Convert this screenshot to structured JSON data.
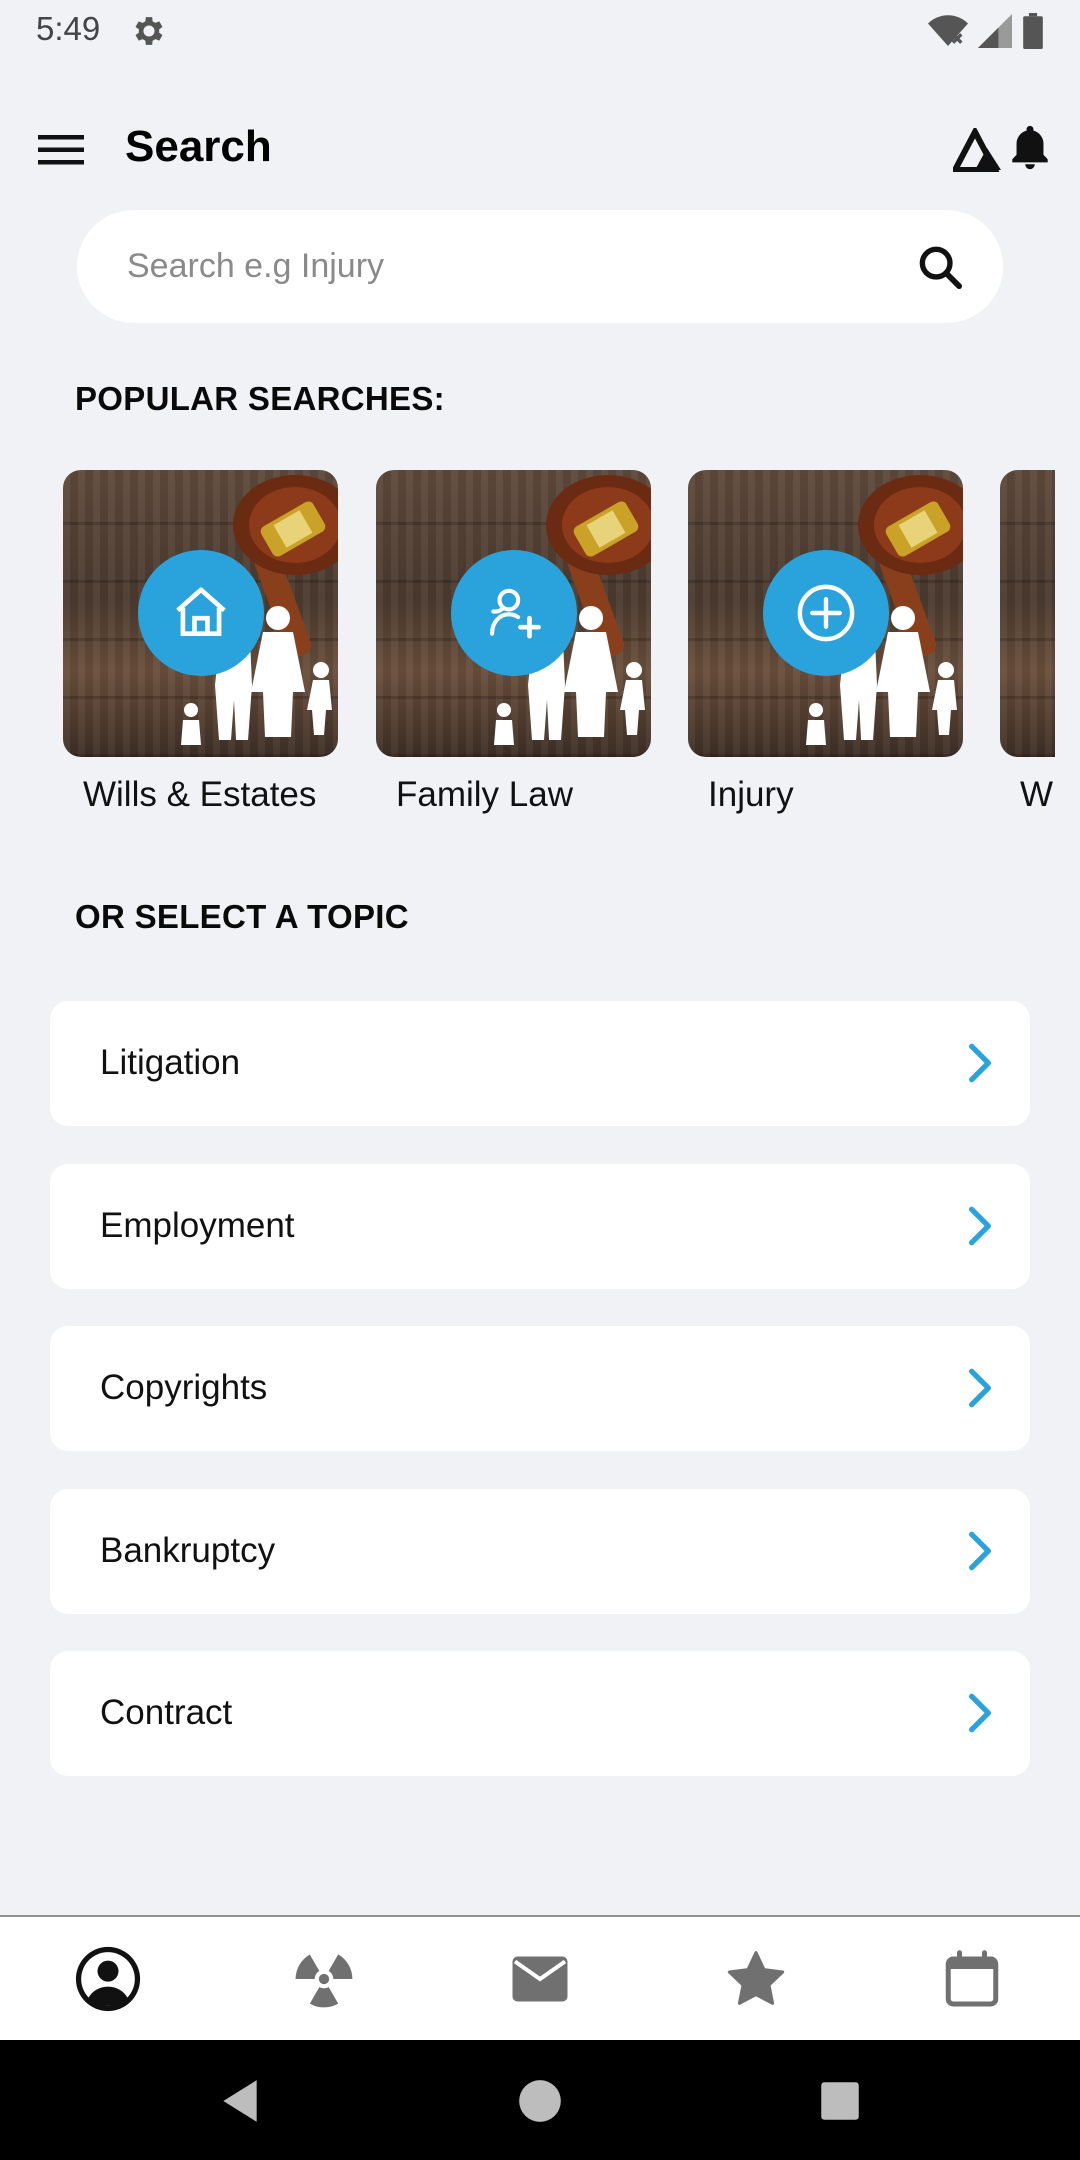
{
  "status_bar": {
    "time": "5:49",
    "icons": [
      "settings-gear-icon",
      "wifi-icon",
      "cell-signal-icon",
      "battery-icon"
    ]
  },
  "app_bar": {
    "title": "Search",
    "icons": [
      "hamburger-menu-icon",
      "brand-logo-icon",
      "bell-icon"
    ]
  },
  "search": {
    "placeholder": "Search e.g Injury",
    "value": ""
  },
  "popular": {
    "heading": "POPULAR SEARCHES:",
    "cards": [
      {
        "label": "Wills & Estates",
        "icon": "house-icon"
      },
      {
        "label": "Family Law",
        "icon": "add-person-icon"
      },
      {
        "label": "Injury",
        "icon": "plus-circle-icon"
      },
      {
        "label": "Wi",
        "icon": ""
      }
    ]
  },
  "topics": {
    "heading": "OR SELECT A TOPIC",
    "items": [
      {
        "label": "Litigation"
      },
      {
        "label": "Employment"
      },
      {
        "label": "Copyrights"
      },
      {
        "label": "Bankruptcy"
      },
      {
        "label": "Contract"
      }
    ]
  },
  "bottom_nav": {
    "items": [
      "profile-icon",
      "radiation-icon",
      "mail-icon",
      "star-icon",
      "calendar-icon"
    ]
  },
  "colors": {
    "accent": "#2aa3dc",
    "background": "#f1f2f6",
    "card": "#ffffff",
    "icon_gray": "#6e6e6e"
  }
}
